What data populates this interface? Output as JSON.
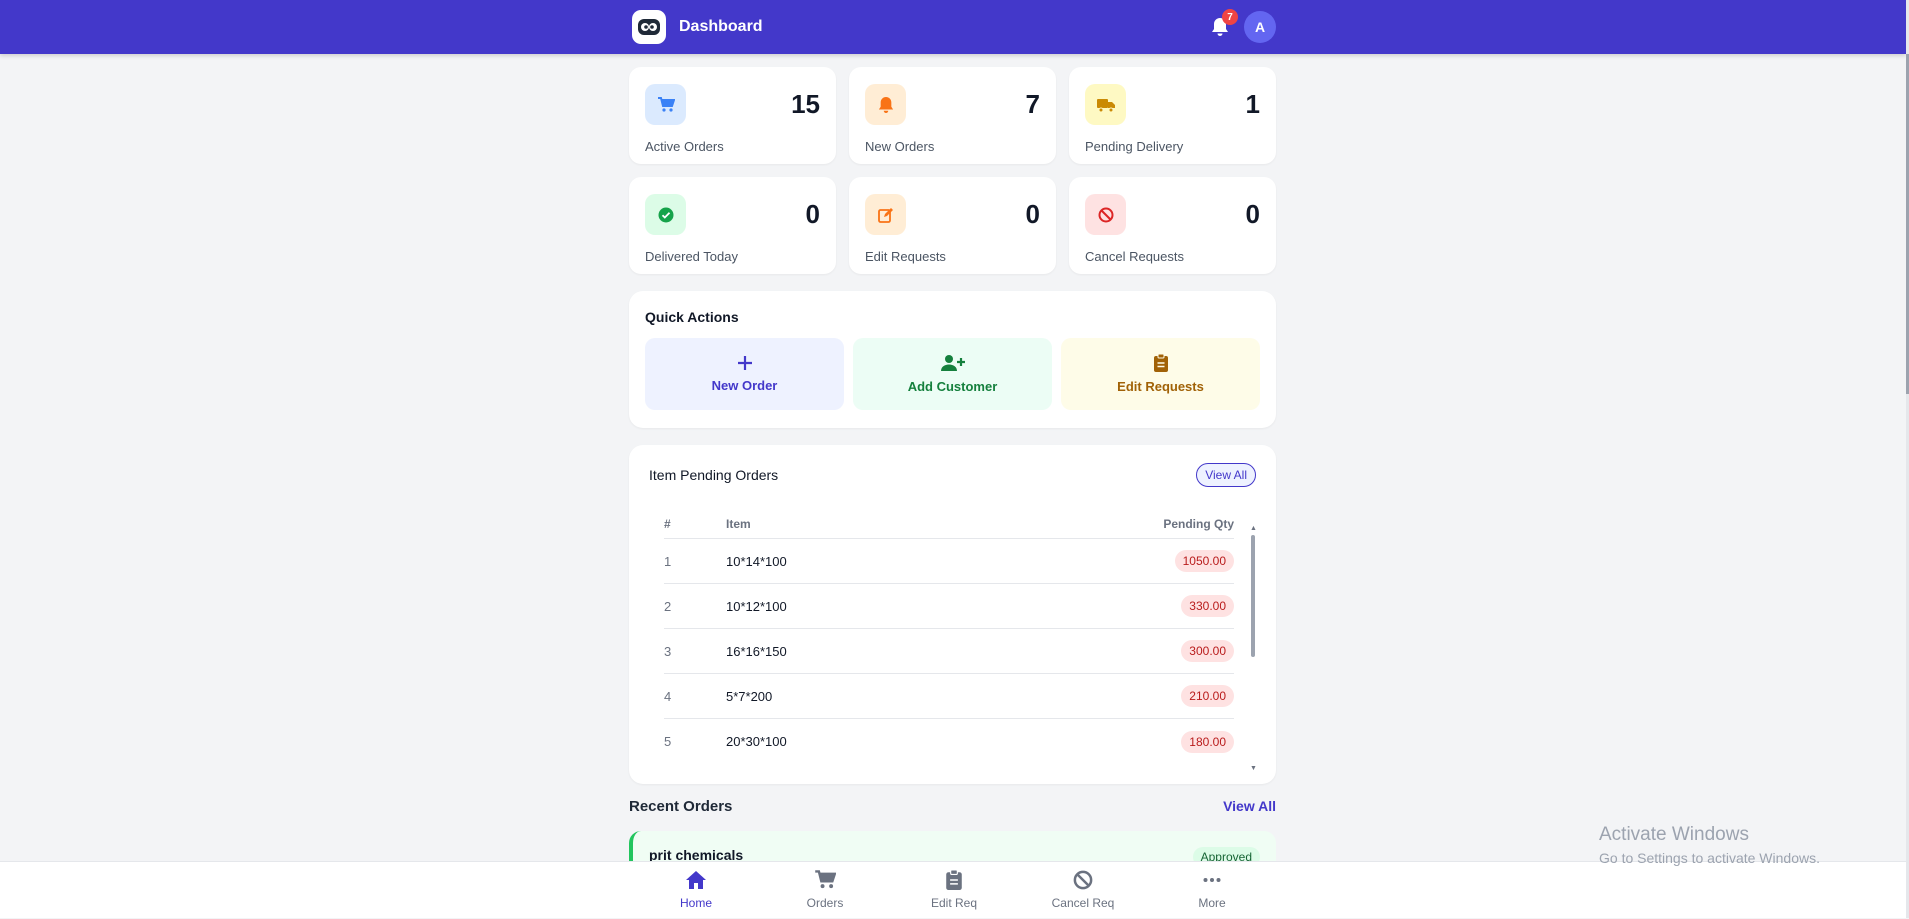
{
  "header": {
    "title": "Dashboard",
    "notification_count": "7",
    "avatar_initial": "A"
  },
  "stats": [
    {
      "label": "Active Orders",
      "value": "15",
      "icon": "cart-icon",
      "color": "#3b82f6",
      "bg": "#dbeafe"
    },
    {
      "label": "New Orders",
      "value": "7",
      "icon": "bell-icon",
      "color": "#f97316",
      "bg": "#ffedd5"
    },
    {
      "label": "Pending Delivery",
      "value": "1",
      "icon": "truck-icon",
      "color": "#ca8a04",
      "bg": "#fef9c3"
    },
    {
      "label": "Delivered Today",
      "value": "0",
      "icon": "check-circle-icon",
      "color": "#16a34a",
      "bg": "#dcfce7"
    },
    {
      "label": "Edit Requests",
      "value": "0",
      "icon": "edit-icon",
      "color": "#f97316",
      "bg": "#ffedd5"
    },
    {
      "label": "Cancel Requests",
      "value": "0",
      "icon": "ban-icon",
      "color": "#dc2626",
      "bg": "#fee2e2"
    }
  ],
  "quick_actions": {
    "title": "Quick Actions",
    "items": [
      {
        "label": "New Order",
        "icon": "plus-icon"
      },
      {
        "label": "Add Customer",
        "icon": "user-plus-icon"
      },
      {
        "label": "Edit Requests",
        "icon": "clipboard-icon"
      }
    ]
  },
  "pending_orders": {
    "title": "Item Pending Orders",
    "view_all": "View All",
    "columns": [
      "#",
      "Item",
      "Pending Qty"
    ],
    "rows": [
      {
        "num": "1",
        "item": "10*14*100",
        "qty": "1050.00"
      },
      {
        "num": "2",
        "item": "10*12*100",
        "qty": "330.00"
      },
      {
        "num": "3",
        "item": "16*16*150",
        "qty": "300.00"
      },
      {
        "num": "4",
        "item": "5*7*200",
        "qty": "210.00"
      },
      {
        "num": "5",
        "item": "20*30*100",
        "qty": "180.00"
      }
    ]
  },
  "recent_orders": {
    "title": "Recent Orders",
    "view_all": "View All",
    "first": {
      "name": "prit chemicals",
      "status": "Approved"
    }
  },
  "bottom_nav": [
    {
      "label": "Home",
      "icon": "home-icon",
      "active": true
    },
    {
      "label": "Orders",
      "icon": "cart-icon",
      "active": false
    },
    {
      "label": "Edit Req",
      "icon": "clipboard-icon",
      "active": false
    },
    {
      "label": "Cancel Req",
      "icon": "ban-icon",
      "active": false
    },
    {
      "label": "More",
      "icon": "more-icon",
      "active": false
    }
  ],
  "watermark": {
    "line1": "Activate Windows",
    "line2": "Go to Settings to activate Windows."
  },
  "colors": {
    "primary": "#4338ca",
    "background": "#f3f4f6"
  }
}
